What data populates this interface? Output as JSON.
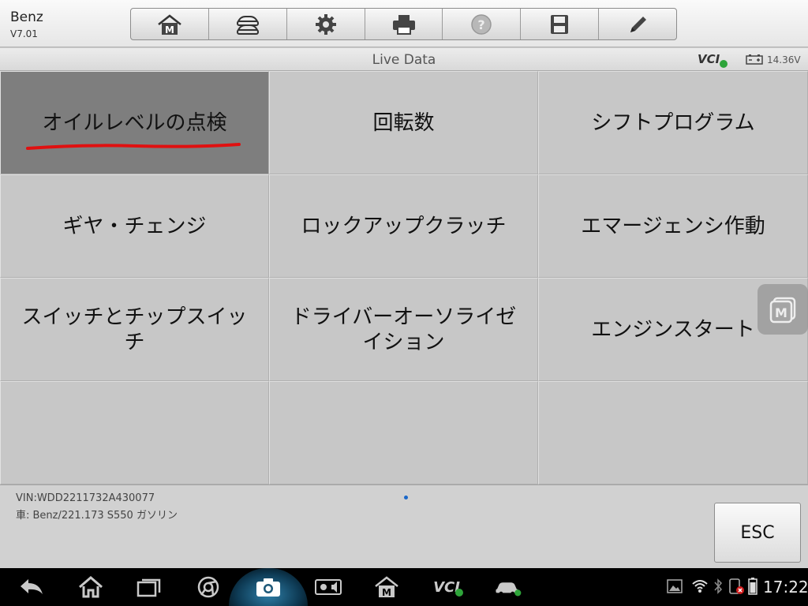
{
  "app": {
    "name": "Benz",
    "version": "V7.01"
  },
  "toolbar": {
    "buttons": [
      {
        "icon": "home-m-icon"
      },
      {
        "icon": "vehicle-swap-icon"
      },
      {
        "icon": "gear-icon"
      },
      {
        "icon": "printer-icon"
      },
      {
        "icon": "help-icon"
      },
      {
        "icon": "save-icon"
      },
      {
        "icon": "pencil-icon"
      }
    ]
  },
  "titlebar": {
    "title": "Live Data",
    "vci_label": "VCI",
    "voltage": "14.36V"
  },
  "grid": {
    "items": [
      {
        "label": "オイルレベルの点検",
        "selected": true
      },
      {
        "label": "回転数"
      },
      {
        "label": "シフトプログラム"
      },
      {
        "label": "ギヤ・チェンジ"
      },
      {
        "label": "ロックアップクラッチ"
      },
      {
        "label": "エマージェンシ作動"
      },
      {
        "label": "スイッチとチップスイッチ"
      },
      {
        "label": "ドライバーオーソライゼイション"
      },
      {
        "label": "エンジンスタート"
      },
      {
        "label": ""
      },
      {
        "label": ""
      },
      {
        "label": ""
      }
    ]
  },
  "footer": {
    "vin": "VIN:WDD2211732A430077",
    "car": "車: Benz/221.173 S550 ガソリン",
    "esc_label": "ESC"
  },
  "statusbar": {
    "time": "17:22",
    "vci_label": "VCI"
  },
  "colors": {
    "selected_cell": "#7e7e7e",
    "cell": "#c7c7c7",
    "accent_dot": "#1a67c9",
    "annotation": "#e01010"
  }
}
